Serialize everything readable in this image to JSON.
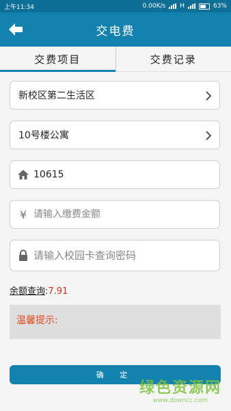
{
  "status": {
    "time": "上午11:34",
    "speed": "0.00K/s",
    "network": "H",
    "battery": "63%"
  },
  "header": {
    "title": "交电费"
  },
  "tabs": [
    {
      "label": "交费项目"
    },
    {
      "label": "交费记录"
    }
  ],
  "form": {
    "campus": "新校区第二生活区",
    "building": "10号楼公寓",
    "room": "10615",
    "amount_placeholder": "请输入缴费金额",
    "password_placeholder": "请输入校园卡查询密码"
  },
  "balance": {
    "label": "余额查询",
    "sep": ":",
    "value": "7.91"
  },
  "tips": {
    "label": "温馨提示:"
  },
  "submit": {
    "label": "确 定"
  },
  "watermark": {
    "name": "绿色资源网",
    "url": "www.downcc.com"
  },
  "colors": {
    "primary": "#1482ae",
    "status_bar": "#0d6e96",
    "balance_value": "#c8321e",
    "tips_text": "#e04a1c"
  }
}
